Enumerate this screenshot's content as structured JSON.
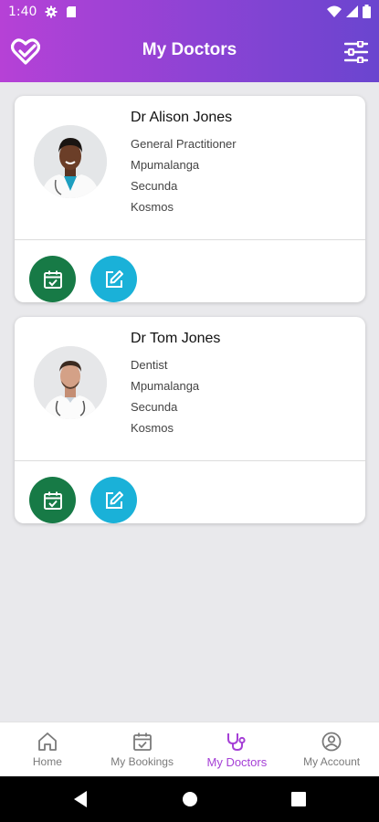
{
  "status_bar": {
    "time": "1:40"
  },
  "header": {
    "title": "My Doctors"
  },
  "doctors": [
    {
      "name": "Dr Alison Jones",
      "specialty": "General Practitioner",
      "province": "Mpumalanga",
      "city": "Secunda",
      "area": "Kosmos"
    },
    {
      "name": "Dr Tom Jones",
      "specialty": "Dentist",
      "province": "Mpumalanga",
      "city": "Secunda",
      "area": "Kosmos"
    }
  ],
  "bottom_nav": [
    {
      "label": "Home",
      "icon": "home-icon"
    },
    {
      "label": "My Bookings",
      "icon": "calendar-check-icon"
    },
    {
      "label": "My Doctors",
      "icon": "stethoscope-icon",
      "active": true
    },
    {
      "label": "My Account",
      "icon": "account-icon"
    }
  ],
  "colors": {
    "gradient_start": "#b641d6",
    "gradient_end": "#6a45cf",
    "book_button": "#177a46",
    "edit_button": "#1ab1d8",
    "active_nav": "#a53fd6"
  }
}
